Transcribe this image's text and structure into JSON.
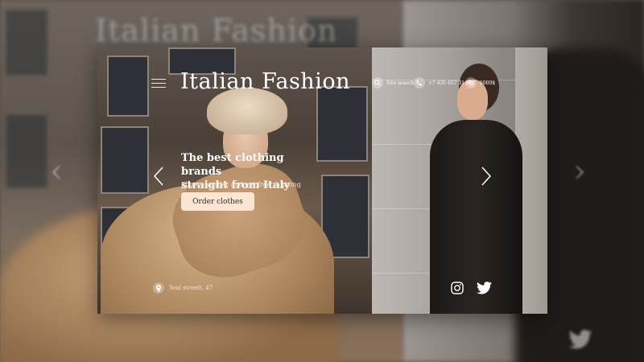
{
  "header": {
    "title": "Italian Fashion",
    "site_search": "Site search",
    "phone": "+7 435 657 31 92",
    "cart_amount": "5000$"
  },
  "hero": {
    "headline_line1": "The best clothing brands",
    "headline_line2": "straight from Italy",
    "subtext": "Place an order and get free shipping",
    "cta_label": "Order clothes"
  },
  "footer": {
    "address": "Youl streett, 47"
  },
  "icons": {
    "menu": "menu-icon",
    "search": "search-icon",
    "phone": "phone-icon",
    "cart": "cart-icon",
    "location": "location-pin-icon",
    "prev": "chevron-left-icon",
    "next": "chevron-right-icon",
    "instagram": "instagram-icon",
    "twitter": "twitter-icon"
  },
  "colors": {
    "cta_bg": "#fbe6d4",
    "cta_text": "#3b2a1e",
    "text_light": "#ffffff"
  }
}
